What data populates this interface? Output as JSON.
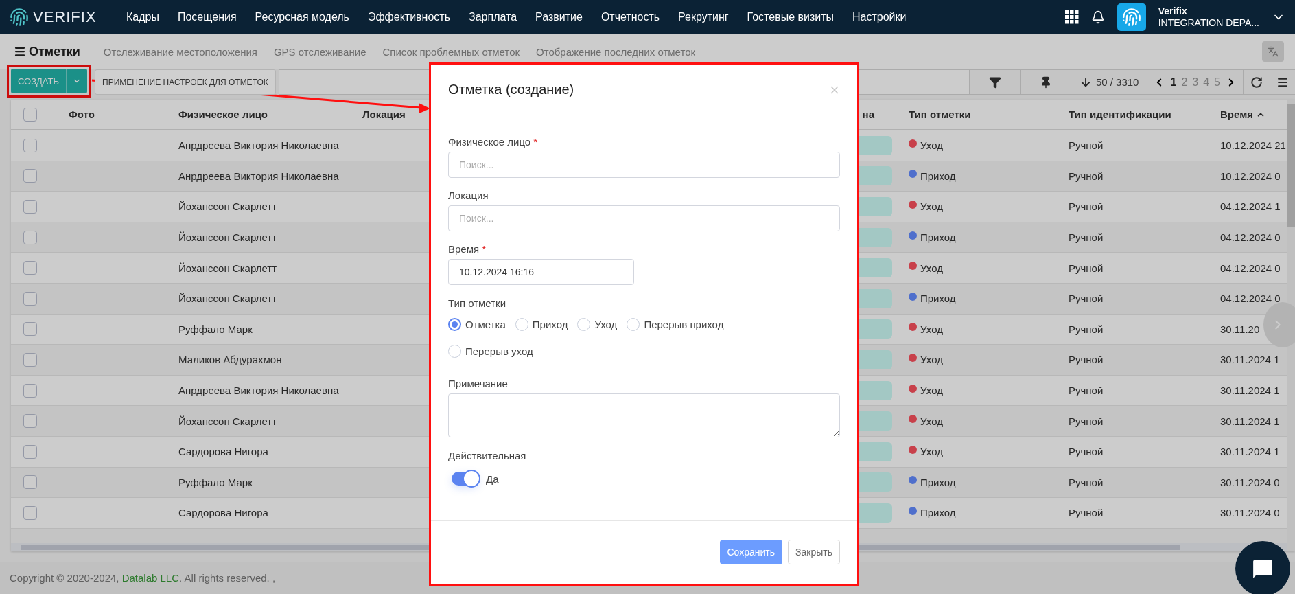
{
  "nav": {
    "brand": "VERIFIX",
    "items": [
      "Кадры",
      "Посещения",
      "Ресурсная модель",
      "Эффективность",
      "Зарплата",
      "Развитие",
      "Отчетность",
      "Рекрутинг",
      "Гостевые визиты",
      "Настройки"
    ],
    "user": {
      "name": "Verifix",
      "org": "INTEGRATION DEPA..."
    }
  },
  "page": {
    "title": "Отметки",
    "tabs": [
      "Отслеживание местоположения",
      "GPS отслеживание",
      "Список проблемных отметок",
      "Отображение последних отметок"
    ]
  },
  "toolbar": {
    "create": "СОЗДАТЬ",
    "apply": "ПРИМЕНЕНИЕ НАСТРОЕК ДЛЯ ОТМЕТОК",
    "count": "50 / 3310",
    "pages": [
      {
        "label": "1",
        "selected": true
      },
      {
        "label": "2",
        "selected": false
      },
      {
        "label": "3",
        "selected": false
      },
      {
        "label": "4",
        "selected": false
      },
      {
        "label": "5",
        "selected": false
      }
    ]
  },
  "table": {
    "select_all_checked": false,
    "columns": [
      {
        "label": "Фото"
      },
      {
        "label": "Физическое лицо"
      },
      {
        "label": "Локация"
      },
      {
        "label": "на"
      },
      {
        "label": "Тип отметки"
      },
      {
        "label": "Тип идентификации"
      },
      {
        "label": "Время",
        "sorted_ascending": true
      }
    ],
    "rows": [
      {
        "checked": false,
        "person": "Анрдреева Виктория Николаевна",
        "mark_type": "Уход",
        "color": "#c8404a",
        "id_type": "Ручной",
        "time": "10.12.2024 21"
      },
      {
        "checked": false,
        "person": "Анрдреева Виктория Николаевна",
        "mark_type": "Приход",
        "color": "#4f6fcc",
        "id_type": "Ручной",
        "time": "10.12.2024 0"
      },
      {
        "checked": false,
        "person": "Йоханссон Скарлетт",
        "mark_type": "Уход",
        "color": "#c8404a",
        "id_type": "Ручной",
        "time": "04.12.2024 1"
      },
      {
        "checked": false,
        "person": "Йоханссон Скарлетт",
        "mark_type": "Приход",
        "color": "#4f6fcc",
        "id_type": "Ручной",
        "time": "04.12.2024 0"
      },
      {
        "checked": false,
        "person": "Йоханссон Скарлетт",
        "mark_type": "Уход",
        "color": "#c8404a",
        "id_type": "Ручной",
        "time": "04.12.2024 0"
      },
      {
        "checked": false,
        "person": "Йоханссон Скарлетт",
        "mark_type": "Приход",
        "color": "#4f6fcc",
        "id_type": "Ручной",
        "time": "04.12.2024 0"
      },
      {
        "checked": false,
        "person": "Руффало Марк",
        "mark_type": "Уход",
        "color": "#c8404a",
        "id_type": "Ручной",
        "time": "30.11.20"
      },
      {
        "checked": false,
        "person": "Маликов Абдурахмон",
        "mark_type": "Уход",
        "color": "#c8404a",
        "id_type": "Ручной",
        "time": "30.11.2024 1"
      },
      {
        "checked": false,
        "person": "Анрдреева Виктория Николаевна",
        "mark_type": "Уход",
        "color": "#c8404a",
        "id_type": "Ручной",
        "time": "30.11.2024 1"
      },
      {
        "checked": false,
        "person": "Йоханссон Скарлетт",
        "mark_type": "Уход",
        "color": "#c8404a",
        "id_type": "Ручной",
        "time": "30.11.2024 1"
      },
      {
        "checked": false,
        "person": "Сардорова Нигора",
        "mark_type": "Уход",
        "color": "#c8404a",
        "id_type": "Ручной",
        "time": "30.11.2024 1"
      },
      {
        "checked": false,
        "person": "Руффало Марк",
        "mark_type": "Приход",
        "color": "#4f6fcc",
        "id_type": "Ручной",
        "time": "30.11.2024 0"
      },
      {
        "checked": false,
        "person": "Сардорова Нигора",
        "mark_type": "Приход",
        "color": "#4f6fcc",
        "id_type": "Ручной",
        "time": "30.11.2024 0"
      }
    ]
  },
  "modal": {
    "title": "Отметка (создание)",
    "fields": [
      {
        "kind": "search",
        "label": "Физическое лицо",
        "required_mark": "*",
        "placeholder": "Поиск..."
      },
      {
        "kind": "search",
        "label": "Локация",
        "placeholder": "Поиск..."
      },
      {
        "kind": "datetime",
        "label": "Время",
        "required_mark": "*",
        "value": "10.12.2024 16:16"
      },
      {
        "kind": "radio",
        "label": "Тип отметки",
        "options": [
          {
            "label": "Отметка",
            "selected": true
          },
          {
            "label": "Приход",
            "selected": false
          },
          {
            "label": "Уход",
            "selected": false
          },
          {
            "label": "Перерыв приход",
            "selected": false
          },
          {
            "label": "Перерыв уход",
            "selected": false
          }
        ]
      },
      {
        "kind": "textarea",
        "label": "Примечание"
      },
      {
        "kind": "switch",
        "label": "Действительная",
        "on": true,
        "caption": "Да"
      }
    ],
    "buttons": [
      {
        "kind": "primary",
        "label": "Сохранить"
      },
      {
        "kind": "secondary",
        "label": "Закрыть"
      }
    ]
  },
  "footer": {
    "before": "Copyright © 2020-2024, ",
    "link": "Datalab LLC",
    "after": ". All rights reserved. ,"
  }
}
